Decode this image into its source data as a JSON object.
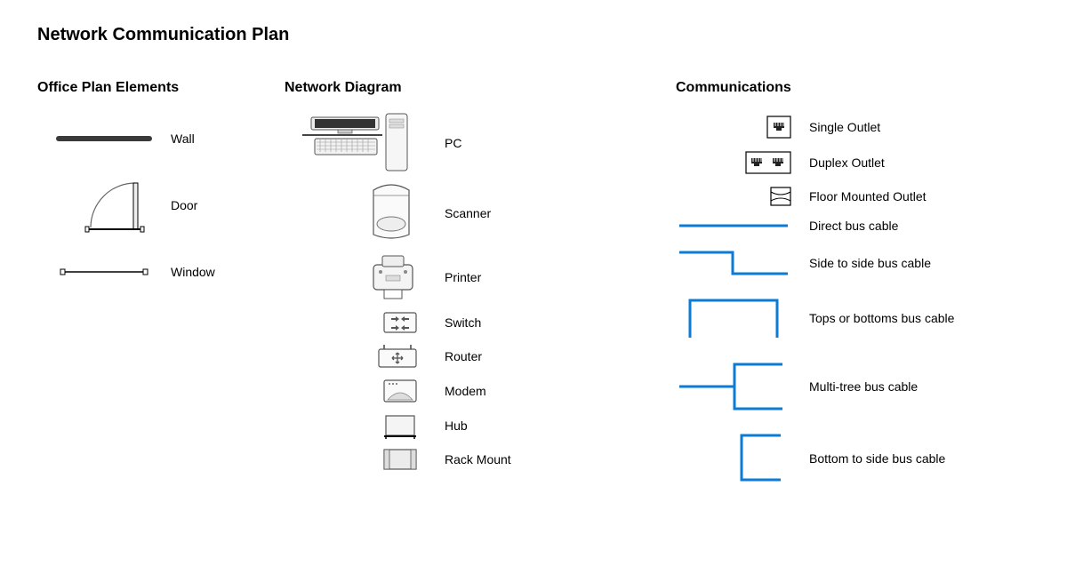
{
  "title": "Network Communication Plan",
  "sections": {
    "office": {
      "title": "Office Plan Elements",
      "items": {
        "wall": {
          "label": "Wall"
        },
        "door": {
          "label": "Door"
        },
        "window": {
          "label": "Window"
        }
      }
    },
    "network": {
      "title": "Network Diagram",
      "items": {
        "pc": {
          "label": "PC"
        },
        "scanner": {
          "label": "Scanner"
        },
        "printer": {
          "label": "Printer"
        },
        "switch": {
          "label": "Switch"
        },
        "router": {
          "label": "Router"
        },
        "modem": {
          "label": "Modem"
        },
        "hub": {
          "label": "Hub"
        },
        "rack": {
          "label": "Rack Mount"
        }
      }
    },
    "comm": {
      "title": "Communications",
      "items": {
        "single_outlet": {
          "label": "Single Outlet"
        },
        "duplex_outlet": {
          "label": "Duplex Outlet"
        },
        "floor_outlet": {
          "label": "Floor Mounted Outlet"
        },
        "direct_bus": {
          "label": "Direct bus cable"
        },
        "side_bus": {
          "label": "Side to side bus cable"
        },
        "tops_bus": {
          "label": "Tops or bottoms bus cable"
        },
        "multi_tree": {
          "label": "Multi-tree bus cable"
        },
        "bottom_side": {
          "label": "Bottom to side bus cable"
        }
      }
    }
  },
  "colors": {
    "cable": "#0a7bd6",
    "stroke": "#000000",
    "fill_light": "#f6f6f6",
    "fill_gray": "#dcdcdc"
  }
}
